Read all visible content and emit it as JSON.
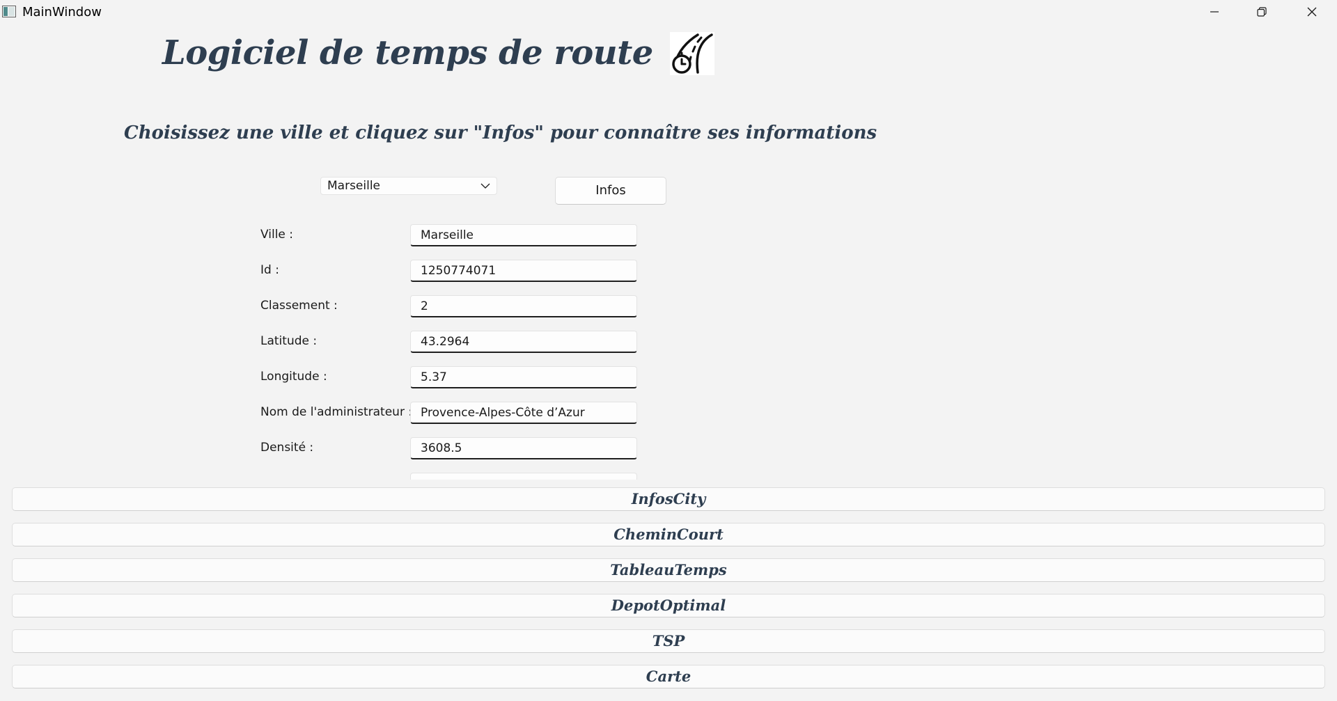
{
  "window": {
    "title": "MainWindow",
    "controls": [
      "minimize",
      "restore",
      "close"
    ]
  },
  "header": {
    "title": "Logiciel de temps de route",
    "logo_icon": "road-timer-icon",
    "subtitle": "Choisissez une ville et cliquez sur \"Infos\" pour connaître ses informations"
  },
  "selector": {
    "selected_city": "Marseille",
    "infos_label": "Infos"
  },
  "form": {
    "fields": [
      {
        "label": "Ville :",
        "value": "Marseille"
      },
      {
        "label": "Id :",
        "value": "1250774071"
      },
      {
        "label": "Classement :",
        "value": "2"
      },
      {
        "label": "Latitude :",
        "value": "43.2964"
      },
      {
        "label": "Longitude :",
        "value": "5.37"
      },
      {
        "label": "Nom de l'administrateur :",
        "value": "Provence-Alpes-Côte d’Azur"
      },
      {
        "label": "Densité :",
        "value": "3608.5"
      }
    ]
  },
  "pages": [
    {
      "label": "InfosCity"
    },
    {
      "label": "CheminCourt"
    },
    {
      "label": "TableauTemps"
    },
    {
      "label": "DepotOptimal"
    },
    {
      "label": "TSP"
    },
    {
      "label": "Carte"
    }
  ],
  "colors": {
    "background": "#f3f3f3",
    "heading": "#2e3e50",
    "field_underline": "#1f1f1f"
  }
}
